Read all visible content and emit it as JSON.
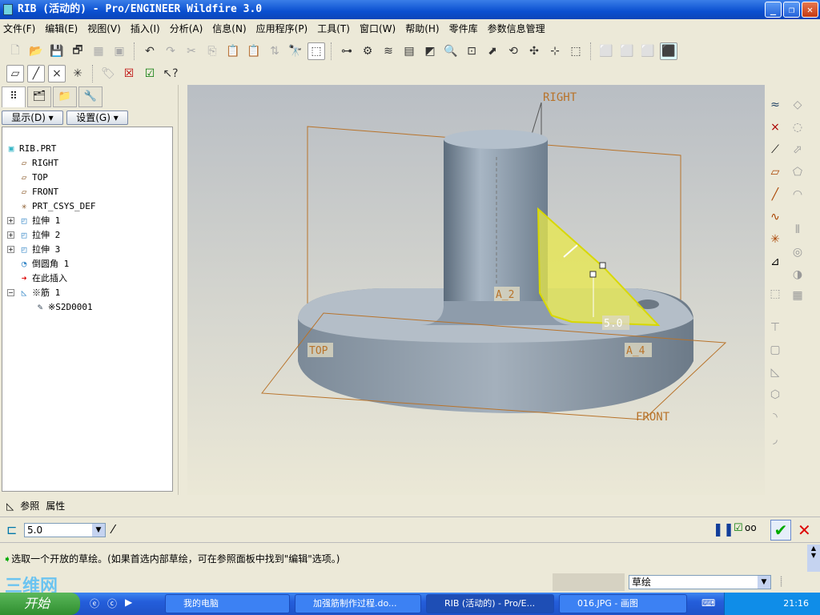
{
  "window": {
    "title": "RIB (活动的) - Pro/ENGINEER Wildfire 3.0",
    "min": "_",
    "max": "❐",
    "close": "✕"
  },
  "menu": [
    "文件(F)",
    "编辑(E)",
    "视图(V)",
    "插入(I)",
    "分析(A)",
    "信息(N)",
    "应用程序(P)",
    "工具(T)",
    "窗口(W)",
    "帮助(H)",
    "零件库",
    "参数信息管理"
  ],
  "panel": {
    "show_btn": "显示(D) ▾",
    "settings_btn": "设置(G) ▾"
  },
  "tree": [
    {
      "label": "RIB.PRT",
      "icon": "part-icon"
    },
    {
      "label": "RIGHT",
      "icon": "datum-plane-icon"
    },
    {
      "label": "TOP",
      "icon": "datum-plane-icon"
    },
    {
      "label": "FRONT",
      "icon": "datum-plane-icon"
    },
    {
      "label": "PRT_CSYS_DEF",
      "icon": "csys-icon"
    },
    {
      "label": "拉伸 1",
      "icon": "extrude-icon",
      "expand": "+"
    },
    {
      "label": "拉伸 2",
      "icon": "extrude-icon",
      "expand": "+"
    },
    {
      "label": "拉伸 3",
      "icon": "extrude-icon",
      "expand": "+"
    },
    {
      "label": "倒圆角 1",
      "icon": "round-icon"
    },
    {
      "label": "在此插入",
      "icon": "insert-here-arrow-icon"
    },
    {
      "label": "※筋 1",
      "icon": "rib-icon",
      "expand": "−"
    },
    {
      "label": "※S2D0001",
      "icon": "sketch-icon"
    }
  ],
  "viewport": {
    "labels": {
      "right": "RIGHT",
      "top": "TOP",
      "front": "FRONT",
      "a2": "A_2",
      "a4": "A_4",
      "dim": "5.0"
    },
    "datum_color": "#b8732a",
    "rib_color": "#e8e84a"
  },
  "dashboard": {
    "tabs": [
      "参照",
      "属性"
    ],
    "thickness": "5.0",
    "ok": "✔",
    "cancel": "✕"
  },
  "message": "选取一个开放的草绘。(如果首选内部草绘，可在参照面板中找到\"编辑\"选项。)",
  "status": {
    "filter": "草绘"
  },
  "taskbar": {
    "start": "开始",
    "tasks": [
      "我的电脑",
      "加强筋制作过程.do...",
      "RIB (活动的) - Pro/E...",
      "016.JPG - 画图"
    ],
    "clock": "21:16"
  },
  "watermark": "三维网"
}
